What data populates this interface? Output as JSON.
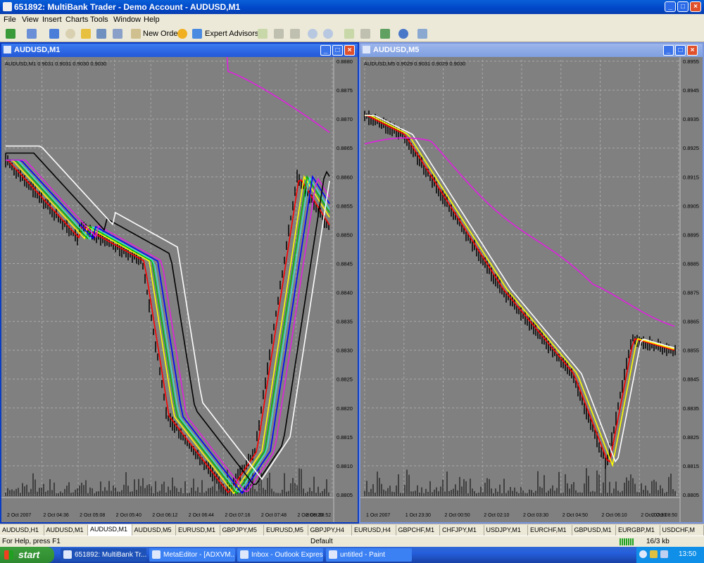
{
  "window": {
    "title": "651892: MultiBank Trader - Demo Account - AUDUSD,M1",
    "min": "_",
    "max": "□",
    "close": "×"
  },
  "menu": [
    "File",
    "View",
    "Insert",
    "Charts",
    "Tools",
    "Window",
    "Help"
  ],
  "toolbar": {
    "new_order": "New Order",
    "expert_advisors": "Expert Advisors"
  },
  "chart1": {
    "title": "AUDUSD,M1",
    "header": "AUDUSD,M1  0.9031 0.9031 0.9030 0.9030",
    "price_ticks": [
      "0.8880",
      "0.8875",
      "0.8870",
      "0.8865",
      "0.8860",
      "0.8855",
      "0.8850",
      "0.8845",
      "0.8840",
      "0.8835",
      "0.8830",
      "0.8825",
      "0.8820",
      "0.8815",
      "0.8810",
      "0.8805"
    ],
    "time_ticks": [
      "2 Oct 2007",
      "2 Oct 04:36",
      "2 Oct 05:08",
      "2 Oct 05:40",
      "2 Oct 06:12",
      "2 Oct 06:44",
      "2 Oct 07:16",
      "2 Oct 07:48",
      "2 Oct 08:20",
      "2 Oct 08:52"
    ]
  },
  "chart2": {
    "title": "AUDUSD,M5",
    "header": "AUDUSD,M5  0.9029 0.9031 0.9029 0.9030",
    "price_ticks": [
      "0.8955",
      "0.8945",
      "0.8935",
      "0.8925",
      "0.8915",
      "0.8905",
      "0.8895",
      "0.8885",
      "0.8875",
      "0.8865",
      "0.8855",
      "0.8845",
      "0.8835",
      "0.8825",
      "0.8815",
      "0.8805"
    ],
    "time_ticks": [
      "1 Oct 2007",
      "1 Oct 23:30",
      "2 Oct 00:50",
      "2 Oct 02:10",
      "2 Oct 03:30",
      "2 Oct 04:50",
      "2 Oct 06:10",
      "2 Oct 07:30",
      "2 Oct 08:50"
    ]
  },
  "tabs": [
    "AUDUSD,H1",
    "AUDUSD,M1",
    "AUDUSD,M1",
    "AUDUSD,M5",
    "EURUSD,M1",
    "GBPJPY,M5",
    "EURUSD,M5",
    "GBPJPY,H4",
    "EURUSD,H4",
    "GBPCHF,M1",
    "CHFJPY,M1",
    "USDJPY,M1",
    "EURCHF,M1",
    "GBPUSD,M1",
    "EURGBP,M1",
    "USDCHF,M"
  ],
  "active_tab_index": 2,
  "status": {
    "help": "For Help, press F1",
    "profile": "Default",
    "traffic": "16/3 kb"
  },
  "taskbar": {
    "start": "start",
    "tasks": [
      "651892: MultiBank Tr...",
      "MetaEditor - [ADXVM...",
      "Inbox - Outlook Express",
      "untitled - Paint"
    ],
    "clock": "13:50"
  },
  "colors": {
    "chart_bg": "#808080",
    "grid": "#a8a8a8",
    "candles": "#000000",
    "ma_red": "#ff0000",
    "ma_yellow": "#ffff00",
    "ma_blue": "#0000ff",
    "ma_green": "#00c000",
    "ma_cyan": "#40e0d0",
    "ma_magenta": "#e020e0",
    "ma_black": "#000000",
    "ma_white": "#ffffff"
  }
}
